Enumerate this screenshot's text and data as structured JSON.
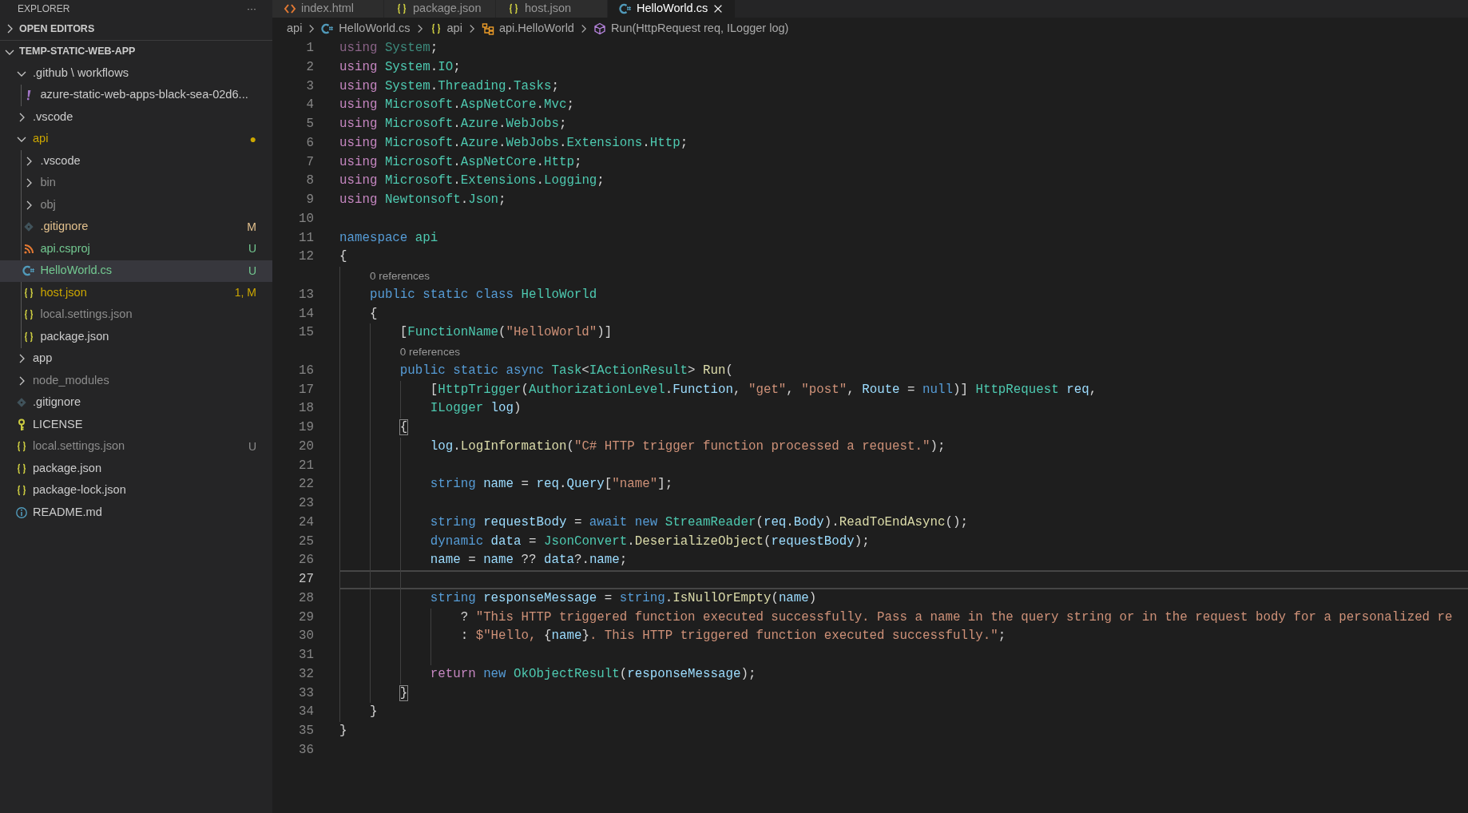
{
  "explorer": {
    "title": "EXPLORER",
    "more": "···",
    "sections": [
      {
        "title": "OPEN EDITORS",
        "expanded": false
      },
      {
        "title": "TEMP-STATIC-WEB-APP",
        "expanded": true,
        "items": [
          {
            "name": ".github \\ workflows",
            "kind": "folder",
            "expanded": true,
            "color": "#cccccc",
            "selected": false,
            "children": [
              {
                "name": "azure-static-web-apps-black-sea-02d6...",
                "kind": "yaml",
                "color": "#cccccc",
                "selected": false
              }
            ]
          },
          {
            "name": ".vscode",
            "kind": "folder",
            "expanded": false,
            "color": "#cccccc",
            "selected": false
          },
          {
            "name": "api",
            "kind": "folder",
            "expanded": true,
            "color": "#cca700",
            "badge": "●",
            "selected": false,
            "children": [
              {
                "name": ".vscode",
                "kind": "folder",
                "expanded": false,
                "color": "#cccccc",
                "selected": false
              },
              {
                "name": "bin",
                "kind": "folder",
                "expanded": false,
                "color": "#8c8c8c",
                "selected": false
              },
              {
                "name": "obj",
                "kind": "folder",
                "expanded": false,
                "color": "#8c8c8c",
                "selected": false
              },
              {
                "name": ".gitignore",
                "kind": "git",
                "color": "#e2c08d",
                "badge": "M",
                "selected": false
              },
              {
                "name": "api.csproj",
                "kind": "rss",
                "color": "#73c991",
                "badge": "U",
                "selected": false
              },
              {
                "name": "HelloWorld.cs",
                "kind": "csharp",
                "color": "#73c991",
                "badge": "U",
                "selected": true
              },
              {
                "name": "host.json",
                "kind": "json",
                "color": "#cca700",
                "badge": "1, M",
                "selected": false
              },
              {
                "name": "local.settings.json",
                "kind": "json",
                "color": "#8c8c8c",
                "selected": false
              },
              {
                "name": "package.json",
                "kind": "json",
                "color": "#cccccc",
                "selected": false
              }
            ]
          },
          {
            "name": "app",
            "kind": "folder",
            "expanded": false,
            "color": "#cccccc",
            "selected": false
          },
          {
            "name": "node_modules",
            "kind": "folder",
            "expanded": false,
            "color": "#8c8c8c",
            "selected": false
          },
          {
            "name": ".gitignore",
            "kind": "git",
            "color": "#cccccc",
            "selected": false
          },
          {
            "name": "LICENSE",
            "kind": "license",
            "color": "#cccccc",
            "selected": false
          },
          {
            "name": "local.settings.json",
            "kind": "json",
            "color": "#8c8c8c",
            "badge": "U",
            "selected": false
          },
          {
            "name": "package.json",
            "kind": "json",
            "color": "#cccccc",
            "selected": false
          },
          {
            "name": "package-lock.json",
            "kind": "json",
            "color": "#cccccc",
            "selected": false
          },
          {
            "name": "README.md",
            "kind": "info",
            "color": "#cccccc",
            "selected": false
          }
        ]
      }
    ]
  },
  "tabs": [
    {
      "label": "index.html",
      "kind": "html",
      "selected": false
    },
    {
      "label": "package.json",
      "kind": "json",
      "selected": false
    },
    {
      "label": "host.json",
      "kind": "json",
      "selected": false
    },
    {
      "label": "HelloWorld.cs",
      "kind": "csharp",
      "selected": true
    }
  ],
  "breadcrumbs": [
    {
      "label": "api",
      "kind": "folder"
    },
    {
      "label": "HelloWorld.cs",
      "kind": "csharp"
    },
    {
      "label": "api",
      "kind": "namespace"
    },
    {
      "label": "api.HelloWorld",
      "kind": "class"
    },
    {
      "label": "Run(HttpRequest req, ILogger log)",
      "kind": "method"
    }
  ],
  "editor": {
    "lines": [
      {
        "kind": "code",
        "number": "1",
        "current": false,
        "tokens": [
          {
            "kind": "dimctl",
            "text": "using "
          },
          {
            "kind": "dimtype",
            "text": "System"
          },
          {
            "kind": "plain",
            "text": ";"
          }
        ]
      },
      {
        "kind": "code",
        "number": "2",
        "current": false,
        "tokens": [
          {
            "kind": "ctl",
            "text": "using "
          },
          {
            "kind": "type",
            "text": "System"
          },
          {
            "kind": "plain",
            "text": "."
          },
          {
            "kind": "type",
            "text": "IO"
          },
          {
            "kind": "plain",
            "text": ";"
          }
        ]
      },
      {
        "kind": "code",
        "number": "3",
        "current": false,
        "tokens": [
          {
            "kind": "ctl",
            "text": "using "
          },
          {
            "kind": "type",
            "text": "System"
          },
          {
            "kind": "plain",
            "text": "."
          },
          {
            "kind": "type",
            "text": "Threading"
          },
          {
            "kind": "plain",
            "text": "."
          },
          {
            "kind": "type",
            "text": "Tasks"
          },
          {
            "kind": "plain",
            "text": ";"
          }
        ]
      },
      {
        "kind": "code",
        "number": "4",
        "current": false,
        "tokens": [
          {
            "kind": "ctl",
            "text": "using "
          },
          {
            "kind": "type",
            "text": "Microsoft"
          },
          {
            "kind": "plain",
            "text": "."
          },
          {
            "kind": "type",
            "text": "AspNetCore"
          },
          {
            "kind": "plain",
            "text": "."
          },
          {
            "kind": "type",
            "text": "Mvc"
          },
          {
            "kind": "plain",
            "text": ";"
          }
        ]
      },
      {
        "kind": "code",
        "number": "5",
        "current": false,
        "tokens": [
          {
            "kind": "ctl",
            "text": "using "
          },
          {
            "kind": "type",
            "text": "Microsoft"
          },
          {
            "kind": "plain",
            "text": "."
          },
          {
            "kind": "type",
            "text": "Azure"
          },
          {
            "kind": "plain",
            "text": "."
          },
          {
            "kind": "type",
            "text": "WebJobs"
          },
          {
            "kind": "plain",
            "text": ";"
          }
        ]
      },
      {
        "kind": "code",
        "number": "6",
        "current": false,
        "tokens": [
          {
            "kind": "ctl",
            "text": "using "
          },
          {
            "kind": "type",
            "text": "Microsoft"
          },
          {
            "kind": "plain",
            "text": "."
          },
          {
            "kind": "type",
            "text": "Azure"
          },
          {
            "kind": "plain",
            "text": "."
          },
          {
            "kind": "type",
            "text": "WebJobs"
          },
          {
            "kind": "plain",
            "text": "."
          },
          {
            "kind": "type",
            "text": "Extensions"
          },
          {
            "kind": "plain",
            "text": "."
          },
          {
            "kind": "type",
            "text": "Http"
          },
          {
            "kind": "plain",
            "text": ";"
          }
        ]
      },
      {
        "kind": "code",
        "number": "7",
        "current": false,
        "tokens": [
          {
            "kind": "ctl",
            "text": "using "
          },
          {
            "kind": "type",
            "text": "Microsoft"
          },
          {
            "kind": "plain",
            "text": "."
          },
          {
            "kind": "type",
            "text": "AspNetCore"
          },
          {
            "kind": "plain",
            "text": "."
          },
          {
            "kind": "type",
            "text": "Http"
          },
          {
            "kind": "plain",
            "text": ";"
          }
        ]
      },
      {
        "kind": "code",
        "number": "8",
        "current": false,
        "tokens": [
          {
            "kind": "ctl",
            "text": "using "
          },
          {
            "kind": "type",
            "text": "Microsoft"
          },
          {
            "kind": "plain",
            "text": "."
          },
          {
            "kind": "type",
            "text": "Extensions"
          },
          {
            "kind": "plain",
            "text": "."
          },
          {
            "kind": "type",
            "text": "Logging"
          },
          {
            "kind": "plain",
            "text": ";"
          }
        ]
      },
      {
        "kind": "code",
        "number": "9",
        "current": false,
        "tokens": [
          {
            "kind": "ctl",
            "text": "using "
          },
          {
            "kind": "type",
            "text": "Newtonsoft"
          },
          {
            "kind": "plain",
            "text": "."
          },
          {
            "kind": "type",
            "text": "Json"
          },
          {
            "kind": "plain",
            "text": ";"
          }
        ]
      },
      {
        "kind": "code",
        "number": "10",
        "current": false
      },
      {
        "kind": "code",
        "number": "11",
        "current": false,
        "tokens": [
          {
            "kind": "kw",
            "text": "namespace "
          },
          {
            "kind": "type",
            "text": "api"
          }
        ]
      },
      {
        "kind": "code",
        "number": "12",
        "current": false,
        "tokens": [
          {
            "kind": "plain",
            "text": "{"
          }
        ]
      },
      {
        "kind": "codelens",
        "text": "0 references"
      },
      {
        "kind": "code",
        "number": "13",
        "current": false,
        "tokens": [
          {
            "kind": "kw",
            "text": "    public static class "
          },
          {
            "kind": "type",
            "text": "HelloWorld"
          }
        ]
      },
      {
        "kind": "code",
        "number": "14",
        "current": false,
        "tokens": [
          {
            "kind": "plain",
            "text": "    {"
          }
        ]
      },
      {
        "kind": "code",
        "number": "15",
        "current": false,
        "tokens": [
          {
            "kind": "plain",
            "text": "        ["
          },
          {
            "kind": "type",
            "text": "FunctionName"
          },
          {
            "kind": "plain",
            "text": "("
          },
          {
            "kind": "str",
            "text": "\"HelloWorld\""
          },
          {
            "kind": "plain",
            "text": ")]"
          }
        ]
      },
      {
        "kind": "codelens",
        "text": "0 references"
      },
      {
        "kind": "code",
        "number": "16",
        "current": false,
        "tokens": [
          {
            "kind": "kw",
            "text": "        public static async "
          },
          {
            "kind": "type",
            "text": "Task"
          },
          {
            "kind": "plain",
            "text": "<"
          },
          {
            "kind": "type",
            "text": "IActionResult"
          },
          {
            "kind": "plain",
            "text": "> "
          },
          {
            "kind": "fn",
            "text": "Run"
          },
          {
            "kind": "plain",
            "text": "("
          }
        ]
      },
      {
        "kind": "code",
        "number": "17",
        "current": false,
        "tokens": [
          {
            "kind": "plain",
            "text": "            ["
          },
          {
            "kind": "type",
            "text": "HttpTrigger"
          },
          {
            "kind": "plain",
            "text": "("
          },
          {
            "kind": "type",
            "text": "AuthorizationLevel"
          },
          {
            "kind": "plain",
            "text": "."
          },
          {
            "kind": "var",
            "text": "Function"
          },
          {
            "kind": "plain",
            "text": ", "
          },
          {
            "kind": "str",
            "text": "\"get\""
          },
          {
            "kind": "plain",
            "text": ", "
          },
          {
            "kind": "str",
            "text": "\"post\""
          },
          {
            "kind": "plain",
            "text": ", "
          },
          {
            "kind": "var",
            "text": "Route"
          },
          {
            "kind": "plain",
            "text": " = "
          },
          {
            "kind": "kw",
            "text": "null"
          },
          {
            "kind": "plain",
            "text": ")] "
          },
          {
            "kind": "type",
            "text": "HttpRequest"
          },
          {
            "kind": "var",
            "text": " req"
          },
          {
            "kind": "plain",
            "text": ","
          }
        ]
      },
      {
        "kind": "code",
        "number": "18",
        "current": false,
        "tokens": [
          {
            "kind": "type",
            "text": "            ILogger"
          },
          {
            "kind": "var",
            "text": " log"
          },
          {
            "kind": "plain",
            "text": ")"
          }
        ]
      },
      {
        "kind": "code",
        "number": "19",
        "current": false,
        "tokens": [
          {
            "kind": "bracket",
            "text": "        {"
          }
        ]
      },
      {
        "kind": "code",
        "number": "20",
        "current": false,
        "tokens": [
          {
            "kind": "var",
            "text": "            log"
          },
          {
            "kind": "plain",
            "text": "."
          },
          {
            "kind": "fn",
            "text": "LogInformation"
          },
          {
            "kind": "plain",
            "text": "("
          },
          {
            "kind": "str",
            "text": "\"C# HTTP trigger function processed a request.\""
          },
          {
            "kind": "plain",
            "text": ");"
          }
        ]
      },
      {
        "kind": "code",
        "number": "21",
        "current": false
      },
      {
        "kind": "code",
        "number": "22",
        "current": false,
        "tokens": [
          {
            "kind": "kw",
            "text": "            string "
          },
          {
            "kind": "var",
            "text": "name"
          },
          {
            "kind": "plain",
            "text": " = "
          },
          {
            "kind": "var",
            "text": "req"
          },
          {
            "kind": "plain",
            "text": "."
          },
          {
            "kind": "var",
            "text": "Query"
          },
          {
            "kind": "plain",
            "text": "["
          },
          {
            "kind": "str",
            "text": "\"name\""
          },
          {
            "kind": "plain",
            "text": "];"
          }
        ]
      },
      {
        "kind": "code",
        "number": "23",
        "current": false
      },
      {
        "kind": "code",
        "number": "24",
        "current": false,
        "tokens": [
          {
            "kind": "kw",
            "text": "            string "
          },
          {
            "kind": "var",
            "text": "requestBody"
          },
          {
            "kind": "plain",
            "text": " = "
          },
          {
            "kind": "kw",
            "text": "await new "
          },
          {
            "kind": "type",
            "text": "StreamReader"
          },
          {
            "kind": "plain",
            "text": "("
          },
          {
            "kind": "var",
            "text": "req"
          },
          {
            "kind": "plain",
            "text": "."
          },
          {
            "kind": "var",
            "text": "Body"
          },
          {
            "kind": "plain",
            "text": ")."
          },
          {
            "kind": "fn",
            "text": "ReadToEndAsync"
          },
          {
            "kind": "plain",
            "text": "();"
          }
        ]
      },
      {
        "kind": "code",
        "number": "25",
        "current": false,
        "tokens": [
          {
            "kind": "kw",
            "text": "            dynamic "
          },
          {
            "kind": "var",
            "text": "data"
          },
          {
            "kind": "plain",
            "text": " = "
          },
          {
            "kind": "type",
            "text": "JsonConvert"
          },
          {
            "kind": "plain",
            "text": "."
          },
          {
            "kind": "fn",
            "text": "DeserializeObject"
          },
          {
            "kind": "plain",
            "text": "("
          },
          {
            "kind": "var",
            "text": "requestBody"
          },
          {
            "kind": "plain",
            "text": ");"
          }
        ]
      },
      {
        "kind": "code",
        "number": "26",
        "current": false,
        "tokens": [
          {
            "kind": "var",
            "text": "            name"
          },
          {
            "kind": "plain",
            "text": " = "
          },
          {
            "kind": "var",
            "text": "name"
          },
          {
            "kind": "plain",
            "text": " ?? "
          },
          {
            "kind": "var",
            "text": "data"
          },
          {
            "kind": "plain",
            "text": "?."
          },
          {
            "kind": "var",
            "text": "name"
          },
          {
            "kind": "plain",
            "text": ";"
          }
        ]
      },
      {
        "kind": "code",
        "number": "27",
        "current": true
      },
      {
        "kind": "code",
        "number": "28",
        "current": false,
        "tokens": [
          {
            "kind": "kw",
            "text": "            string "
          },
          {
            "kind": "var",
            "text": "responseMessage"
          },
          {
            "kind": "plain",
            "text": " = "
          },
          {
            "kind": "kw",
            "text": "string"
          },
          {
            "kind": "plain",
            "text": "."
          },
          {
            "kind": "fn",
            "text": "IsNullOrEmpty"
          },
          {
            "kind": "plain",
            "text": "("
          },
          {
            "kind": "var",
            "text": "name"
          },
          {
            "kind": "plain",
            "text": ")"
          }
        ]
      },
      {
        "kind": "code",
        "number": "29",
        "current": false,
        "tokens": [
          {
            "kind": "plain",
            "text": "                ? "
          },
          {
            "kind": "str",
            "text": "\"This HTTP triggered function executed successfully. Pass a name in the query string or in the request body for a personalized re"
          }
        ]
      },
      {
        "kind": "code",
        "number": "30",
        "current": false,
        "tokens": [
          {
            "kind": "plain",
            "text": "                : "
          },
          {
            "kind": "str",
            "text": "$\"Hello, "
          },
          {
            "kind": "plain",
            "text": "{"
          },
          {
            "kind": "var",
            "text": "name"
          },
          {
            "kind": "plain",
            "text": "}"
          },
          {
            "kind": "str",
            "text": ". This HTTP triggered function executed successfully.\""
          },
          {
            "kind": "plain",
            "text": ";"
          }
        ]
      },
      {
        "kind": "code",
        "number": "31",
        "current": false
      },
      {
        "kind": "code",
        "number": "32",
        "current": false,
        "tokens": [
          {
            "kind": "ctl",
            "text": "            return "
          },
          {
            "kind": "kw",
            "text": "new "
          },
          {
            "kind": "type",
            "text": "OkObjectResult"
          },
          {
            "kind": "plain",
            "text": "("
          },
          {
            "kind": "var",
            "text": "responseMessage"
          },
          {
            "kind": "plain",
            "text": ");"
          }
        ]
      },
      {
        "kind": "code",
        "number": "33",
        "current": false,
        "tokens": [
          {
            "kind": "bracket",
            "text": "        }"
          }
        ]
      },
      {
        "kind": "code",
        "number": "34",
        "current": false,
        "tokens": [
          {
            "kind": "plain",
            "text": "    }"
          }
        ]
      },
      {
        "kind": "code",
        "number": "35",
        "current": false,
        "tokens": [
          {
            "kind": "plain",
            "text": "}"
          }
        ]
      },
      {
        "kind": "code",
        "number": "36",
        "current": false
      }
    ]
  }
}
